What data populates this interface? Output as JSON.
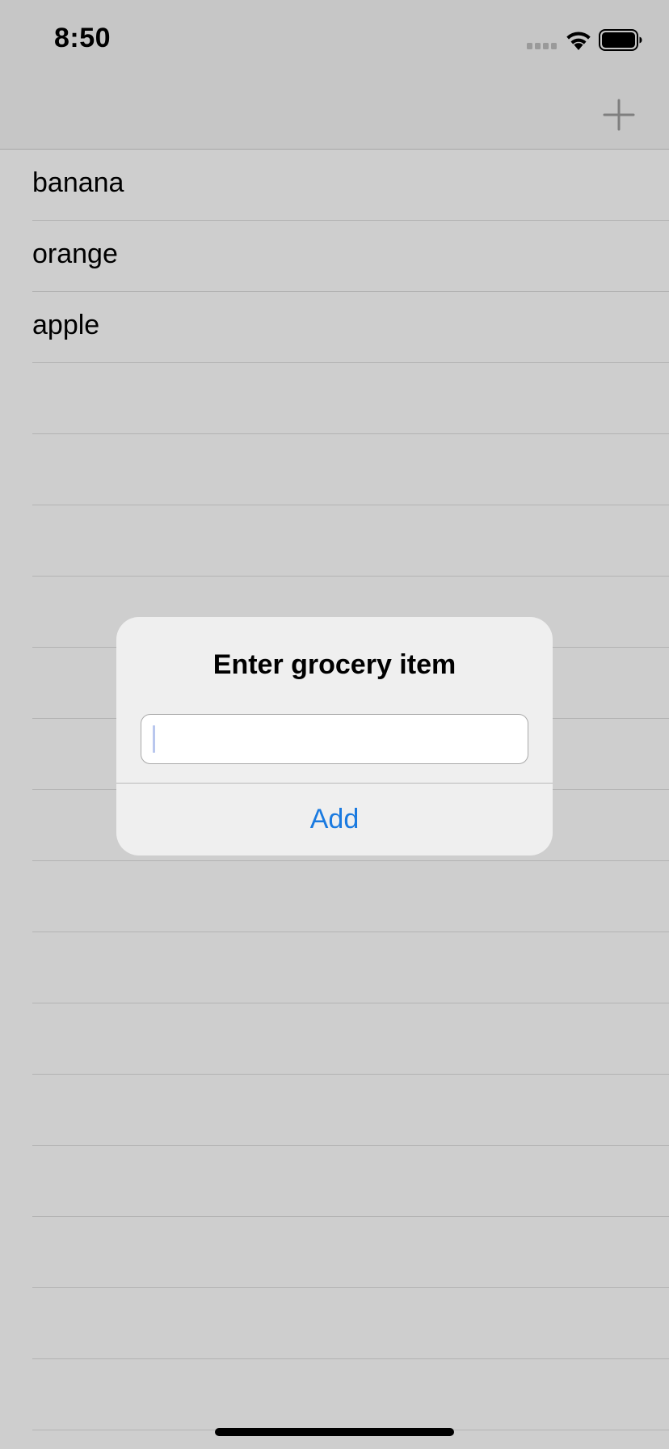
{
  "status_bar": {
    "time": "8:50"
  },
  "nav_bar": {
    "add_icon": "plus-icon"
  },
  "grocery_list": {
    "items": [
      "banana",
      "orange",
      "apple",
      "",
      "",
      "",
      "",
      "",
      "",
      "",
      "",
      "",
      "",
      "",
      "",
      "",
      "",
      ""
    ]
  },
  "alert": {
    "title": "Enter grocery item",
    "input_value": "",
    "input_placeholder": "",
    "add_label": "Add"
  },
  "colors": {
    "accent": "#1a7ae0",
    "background": "#cecece",
    "alert_background": "#efefef"
  }
}
